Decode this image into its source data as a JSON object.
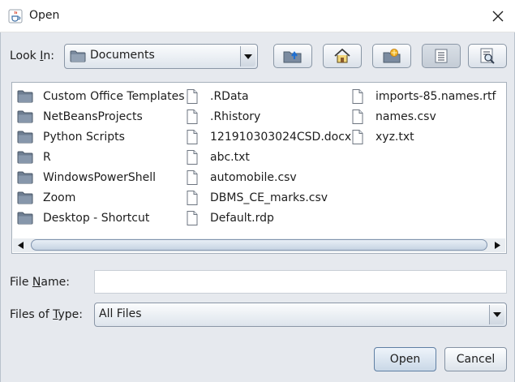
{
  "window": {
    "title": "Open",
    "close_icon": "close-icon",
    "app_icon": "java-cup-icon"
  },
  "look_in": {
    "label": "Look In:",
    "value": "Documents"
  },
  "toolbar": [
    {
      "name": "up-one-level-button",
      "icon": "folder-up-icon"
    },
    {
      "name": "home-button",
      "icon": "home-icon"
    },
    {
      "name": "create-new-folder-button",
      "icon": "new-folder-icon"
    },
    {
      "name": "list-view-button",
      "icon": "list-view-icon",
      "active": true
    },
    {
      "name": "details-view-button",
      "icon": "details-view-icon"
    }
  ],
  "files": {
    "columns": [
      [
        {
          "name": "Custom Office Templates",
          "type": "folder"
        },
        {
          "name": "NetBeansProjects",
          "type": "folder"
        },
        {
          "name": "Python Scripts",
          "type": "folder"
        },
        {
          "name": "R",
          "type": "folder"
        },
        {
          "name": "WindowsPowerShell",
          "type": "folder"
        },
        {
          "name": "Zoom",
          "type": "folder"
        },
        {
          "name": "Desktop - Shortcut",
          "type": "folder"
        }
      ],
      [
        {
          "name": ".RData",
          "type": "file"
        },
        {
          "name": ".Rhistory",
          "type": "file"
        },
        {
          "name": "121910303024CSD.docx",
          "type": "file"
        },
        {
          "name": "abc.txt",
          "type": "file"
        },
        {
          "name": "automobile.csv",
          "type": "file"
        },
        {
          "name": "DBMS_CE_marks.csv",
          "type": "file"
        },
        {
          "name": "Default.rdp",
          "type": "file"
        }
      ],
      [
        {
          "name": "imports-85.names.rtf",
          "type": "file"
        },
        {
          "name": "names.csv",
          "type": "file"
        },
        {
          "name": "xyz.txt",
          "type": "file"
        }
      ]
    ]
  },
  "file_name": {
    "label": "File Name:",
    "value": ""
  },
  "files_of_type": {
    "label": "Files of Type:",
    "value": "All Files"
  },
  "buttons": {
    "open": "Open",
    "cancel": "Cancel"
  },
  "colors": {
    "background": "#e6e9ee",
    "folder": "#6e7e92",
    "button_border": "#8492a3"
  }
}
